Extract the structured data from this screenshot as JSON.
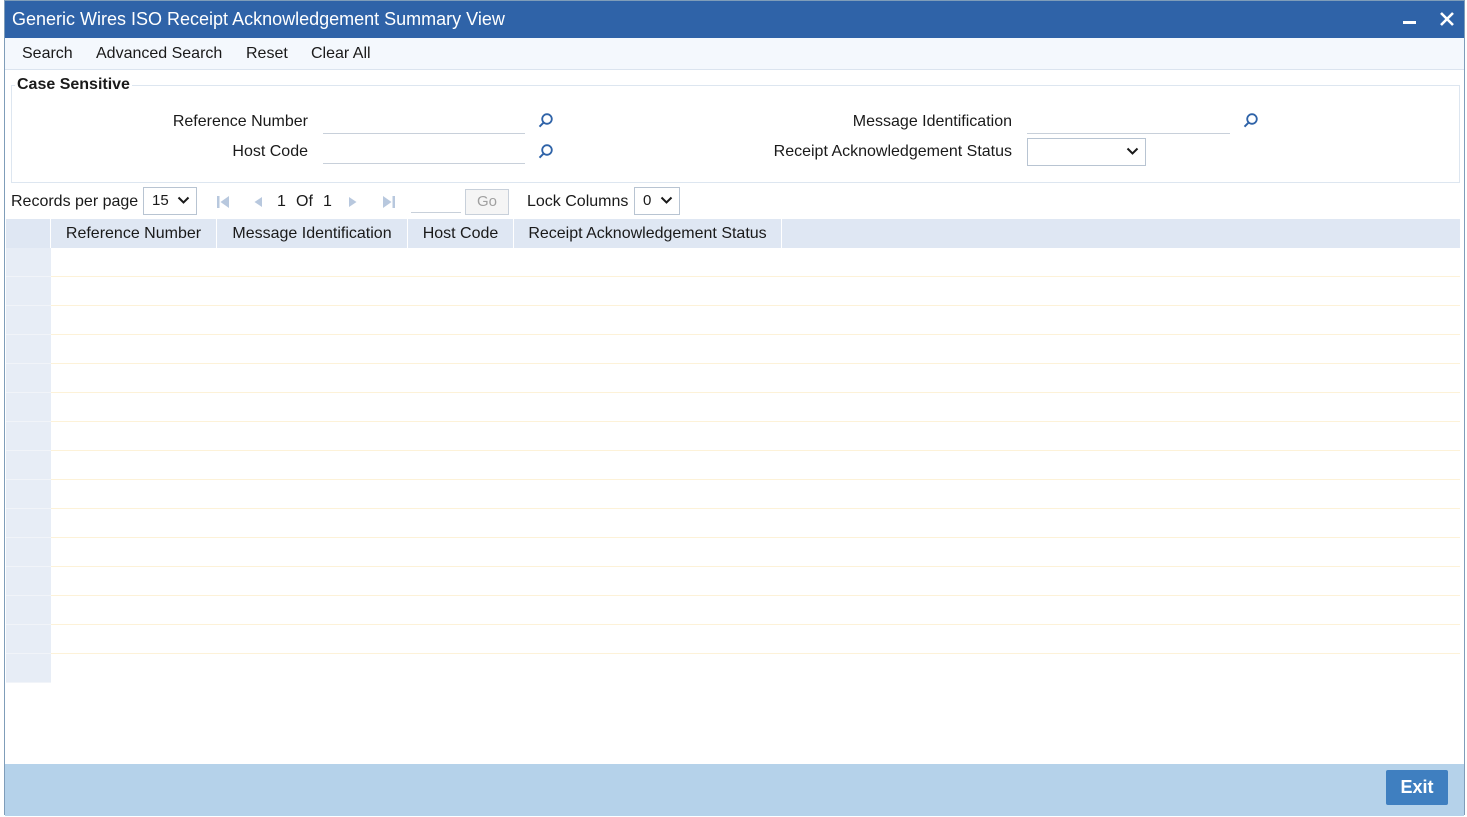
{
  "window": {
    "title": "Generic Wires ISO Receipt Acknowledgement Summary View",
    "minimize_icon": "minimize-icon",
    "close_icon": "close-icon"
  },
  "menu": {
    "items": [
      "Search",
      "Advanced Search",
      "Reset",
      "Clear All"
    ]
  },
  "criteria": {
    "legend": "Case Sensitive",
    "fields": {
      "reference_number": {
        "label": "Reference Number",
        "value": ""
      },
      "host_code": {
        "label": "Host Code",
        "value": ""
      },
      "message_identification": {
        "label": "Message Identification",
        "value": ""
      },
      "receipt_ack_status": {
        "label": "Receipt Acknowledgement Status",
        "value": ""
      }
    },
    "lov_icon": "search-icon"
  },
  "pager": {
    "records_label": "Records per page",
    "records_value": "15",
    "current_page": "1",
    "of_label": "Of",
    "total_pages": "1",
    "go_label": "Go",
    "lock_label": "Lock Columns",
    "lock_value": "0"
  },
  "grid": {
    "columns": [
      "Reference Number",
      "Message Identification",
      "Host Code",
      "Receipt Acknowledgement Status"
    ],
    "rows": []
  },
  "footer": {
    "exit_label": "Exit"
  },
  "colors": {
    "title_bar": "#2f63a8",
    "footer": "#b5d2ea",
    "exit_button": "#3f7fc0",
    "grid_header": "#dfe7f3"
  }
}
